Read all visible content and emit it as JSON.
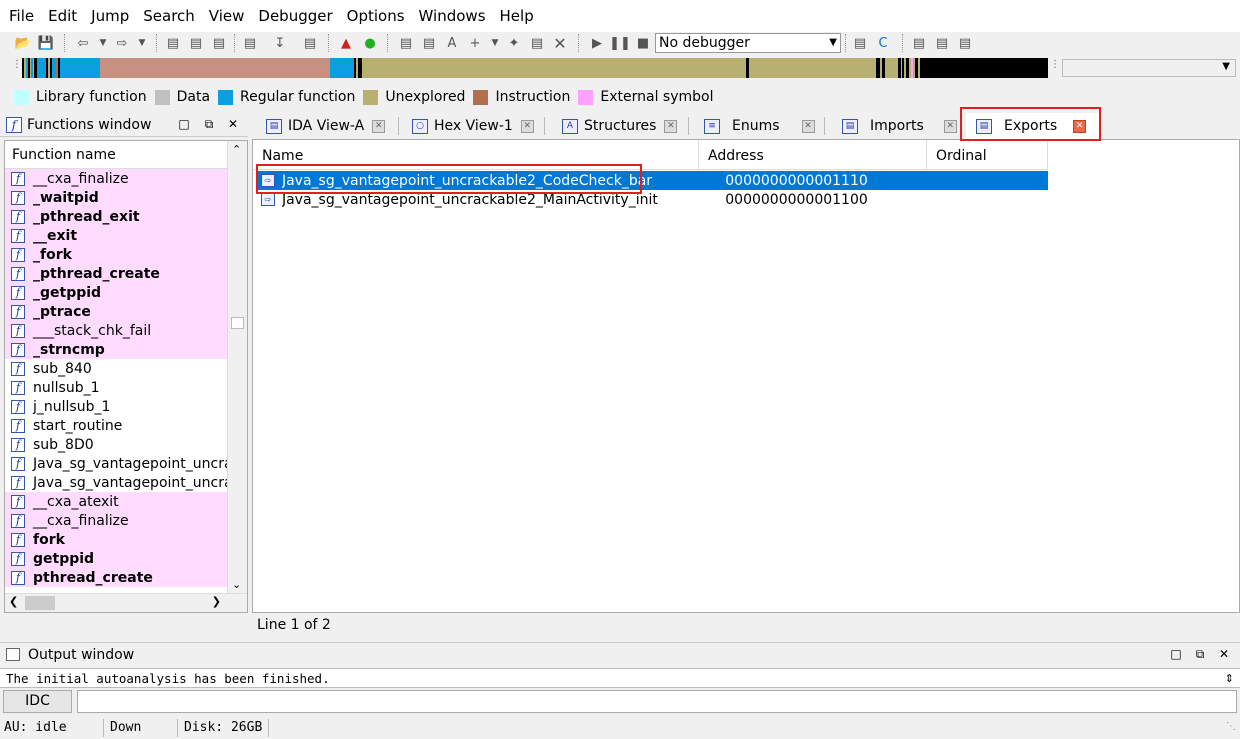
{
  "menu": [
    "File",
    "Edit",
    "Jump",
    "Search",
    "View",
    "Debugger",
    "Options",
    "Windows",
    "Help"
  ],
  "toolbar": {
    "debugger_selected": "No debugger"
  },
  "colors": {
    "library": "#c0ffff",
    "data": "#c0c0c0",
    "regular": "#0aa0e0",
    "unexplored": "#b8b070",
    "instruction": "#b07050",
    "external": "#ffa0ff",
    "selection": "#0078d7",
    "highlight_box": "#e02020"
  },
  "legend": [
    {
      "label": "Library function",
      "color": "#c0ffff"
    },
    {
      "label": "Data",
      "color": "#c0c0c0"
    },
    {
      "label": "Regular function",
      "color": "#0aa0e0"
    },
    {
      "label": "Unexplored",
      "color": "#b8b070"
    },
    {
      "label": "Instruction",
      "color": "#b07050"
    },
    {
      "label": "External symbol",
      "color": "#ffa0ff"
    }
  ],
  "functions_window": {
    "title": "Functions window",
    "column": "Function name",
    "items": [
      {
        "name": "__cxa_finalize",
        "lib": true,
        "bold": false
      },
      {
        "name": "_waitpid",
        "lib": true,
        "bold": true
      },
      {
        "name": "_pthread_exit",
        "lib": true,
        "bold": true
      },
      {
        "name": "__exit",
        "lib": true,
        "bold": true
      },
      {
        "name": "_fork",
        "lib": true,
        "bold": true
      },
      {
        "name": "_pthread_create",
        "lib": true,
        "bold": true
      },
      {
        "name": "_getppid",
        "lib": true,
        "bold": true
      },
      {
        "name": "_ptrace",
        "lib": true,
        "bold": true
      },
      {
        "name": "___stack_chk_fail",
        "lib": true,
        "bold": false
      },
      {
        "name": "_strncmp",
        "lib": true,
        "bold": true
      },
      {
        "name": "sub_840",
        "lib": false,
        "bold": false
      },
      {
        "name": "nullsub_1",
        "lib": false,
        "bold": false
      },
      {
        "name": "j_nullsub_1",
        "lib": false,
        "bold": false
      },
      {
        "name": "start_routine",
        "lib": false,
        "bold": false
      },
      {
        "name": "sub_8D0",
        "lib": false,
        "bold": false
      },
      {
        "name": "Java_sg_vantagepoint_uncrac",
        "lib": false,
        "bold": false
      },
      {
        "name": "Java_sg_vantagepoint_uncrac",
        "lib": false,
        "bold": false
      },
      {
        "name": "__cxa_atexit",
        "lib": true,
        "bold": false
      },
      {
        "name": "__cxa_finalize",
        "lib": true,
        "bold": false
      },
      {
        "name": "fork",
        "lib": true,
        "bold": true
      },
      {
        "name": "getppid",
        "lib": true,
        "bold": true
      },
      {
        "name": "pthread_create",
        "lib": true,
        "bold": true
      }
    ]
  },
  "tabs": [
    {
      "label": "IDA View-A",
      "active": false
    },
    {
      "label": "Hex View-1",
      "active": false
    },
    {
      "label": "Structures",
      "active": false
    },
    {
      "label": "Enums",
      "active": false
    },
    {
      "label": "Imports",
      "active": false
    },
    {
      "label": "Exports",
      "active": true
    }
  ],
  "exports": {
    "columns": [
      "Name",
      "Address",
      "Ordinal"
    ],
    "rows": [
      {
        "name": "Java_sg_vantagepoint_uncrackable2_CodeCheck_bar",
        "address": "0000000000001110",
        "ordinal": "",
        "selected": true
      },
      {
        "name": "Java_sg_vantagepoint_uncrackable2_MainActivity_init",
        "address": "0000000000001100",
        "ordinal": "",
        "selected": false
      }
    ],
    "status": "Line 1 of 2"
  },
  "output_window": {
    "title": "Output window",
    "text": "The initial autoanalysis has been finished.",
    "idc_label": "IDC"
  },
  "statusbar": {
    "au": "AU:  idle",
    "direction": "Down",
    "disk": "Disk: 26GB"
  }
}
